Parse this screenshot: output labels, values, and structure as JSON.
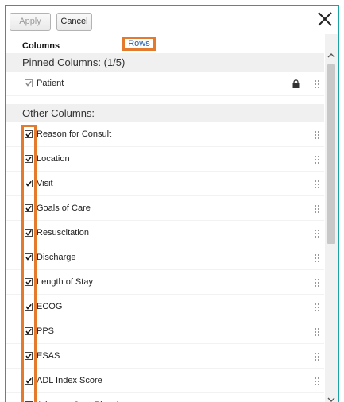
{
  "toolbar": {
    "apply_label": "Apply",
    "cancel_label": "Cancel"
  },
  "tabs": {
    "columns_label": "Columns",
    "rows_label": "Rows"
  },
  "pinned": {
    "header": "Pinned Columns: (1/5)",
    "items": [
      {
        "label": "Patient",
        "checked": true
      }
    ]
  },
  "other": {
    "header": "Other Columns:",
    "items": [
      {
        "label": "Reason for Consult",
        "checked": true
      },
      {
        "label": "Location",
        "checked": true
      },
      {
        "label": "Visit",
        "checked": true
      },
      {
        "label": "Goals of Care",
        "checked": true
      },
      {
        "label": "Resuscitation",
        "checked": true
      },
      {
        "label": "Discharge",
        "checked": true
      },
      {
        "label": "Length of Stay",
        "checked": true
      },
      {
        "label": "ECOG",
        "checked": true
      },
      {
        "label": "PPS",
        "checked": true
      },
      {
        "label": "ESAS",
        "checked": true
      },
      {
        "label": "ADL Index Score",
        "checked": true
      },
      {
        "label": "Advance Care Planning",
        "checked": true
      }
    ]
  },
  "icons": {
    "close": "close-icon",
    "lock": "lock-icon",
    "drag": "drag-handle-icon",
    "check": "check-icon"
  },
  "colors": {
    "accent_border": "#1aa3a3",
    "highlight": "#e37a2d",
    "link": "#1f5fad"
  }
}
